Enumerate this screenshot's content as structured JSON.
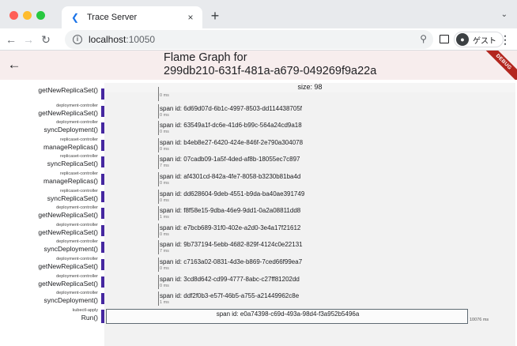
{
  "browser": {
    "tab_title": "Trace Server",
    "tab_close": "×",
    "new_tab": "+",
    "tab_menu": "⌄",
    "url_host": "localhost",
    "url_port": ":10050",
    "profile_label": "ゲスト",
    "traffic_colors": [
      "#ff5f57",
      "#febc2e",
      "#28c840"
    ]
  },
  "app": {
    "title_line1": "Flame Graph for",
    "title_line2": "299db210-631f-481a-a679-049269f9a22a",
    "debug_banner": "DEBUG",
    "size_label": "size: 98"
  },
  "rows": [
    {
      "ns": "",
      "fn": "getNewReplicaSet()",
      "span": "",
      "ms": "0 ms"
    },
    {
      "ns": "deployment-controller",
      "fn": "getNewReplicaSet()",
      "span": "span id: 6d69d07d-6b1c-4997-8503-dd114438705f",
      "ms": "0 ms"
    },
    {
      "ns": "deployment-controller",
      "fn": "syncDeployment()",
      "span": "span id: 63549a1f-dc6e-41d6-b99c-564a24cd9a18",
      "ms": "0 ms"
    },
    {
      "ns": "replicaset-controller",
      "fn": "manageReplicas()",
      "span": "span id: b4eb8e27-6420-424e-846f-2e790a304078",
      "ms": "0 ms"
    },
    {
      "ns": "replicaset-controller",
      "fn": "syncReplicaSet()",
      "span": "span id: 07cadb09-1a5f-4ded-af8b-18055ec7c897",
      "ms": "7 ms"
    },
    {
      "ns": "replicaset-controller",
      "fn": "manageReplicas()",
      "span": "span id: af4301cd-842a-4fe7-8058-b3230b81ba4d",
      "ms": "0 ms"
    },
    {
      "ns": "replicaset-controller",
      "fn": "syncReplicaSet()",
      "span": "span id: dd628604-9deb-4551-b9da-ba40ae391749",
      "ms": "0 ms"
    },
    {
      "ns": "deployment-controller",
      "fn": "getNewReplicaSet()",
      "span": "span id: f8f58e15-9dba-46e9-9dd1-0a2a08811dd8",
      "ms": "1 ms"
    },
    {
      "ns": "deployment-controller",
      "fn": "getNewReplicaSet()",
      "span": "span id: e7bcb689-31f0-402e-a2d0-3e4a17f21612",
      "ms": "0 ms"
    },
    {
      "ns": "deployment-controller",
      "fn": "syncDeployment()",
      "span": "span id: 9b737194-5ebb-4682-829f-4124c0e22131",
      "ms": "7 ms"
    },
    {
      "ns": "deployment-controller",
      "fn": "getNewReplicaSet()",
      "span": "span id: c7163a02-0831-4d3e-b869-7ced66f99ea7",
      "ms": "0 ms"
    },
    {
      "ns": "deployment-controller",
      "fn": "getNewReplicaSet()",
      "span": "span id: 3cd8d642-cd99-4777-8abc-c27ff81202dd",
      "ms": "0 ms"
    },
    {
      "ns": "deployment-controller",
      "fn": "syncDeployment()",
      "span": "span id: ddf2f0b3-e57f-46b5-a755-a21449962c8e",
      "ms": "1 ms"
    }
  ],
  "root": {
    "ns": "kubectl-apply",
    "fn": "Run()",
    "span": "span id: e0a74398-c69d-493a-98d4-f3a952b5496a",
    "ms": "10076 ms"
  }
}
